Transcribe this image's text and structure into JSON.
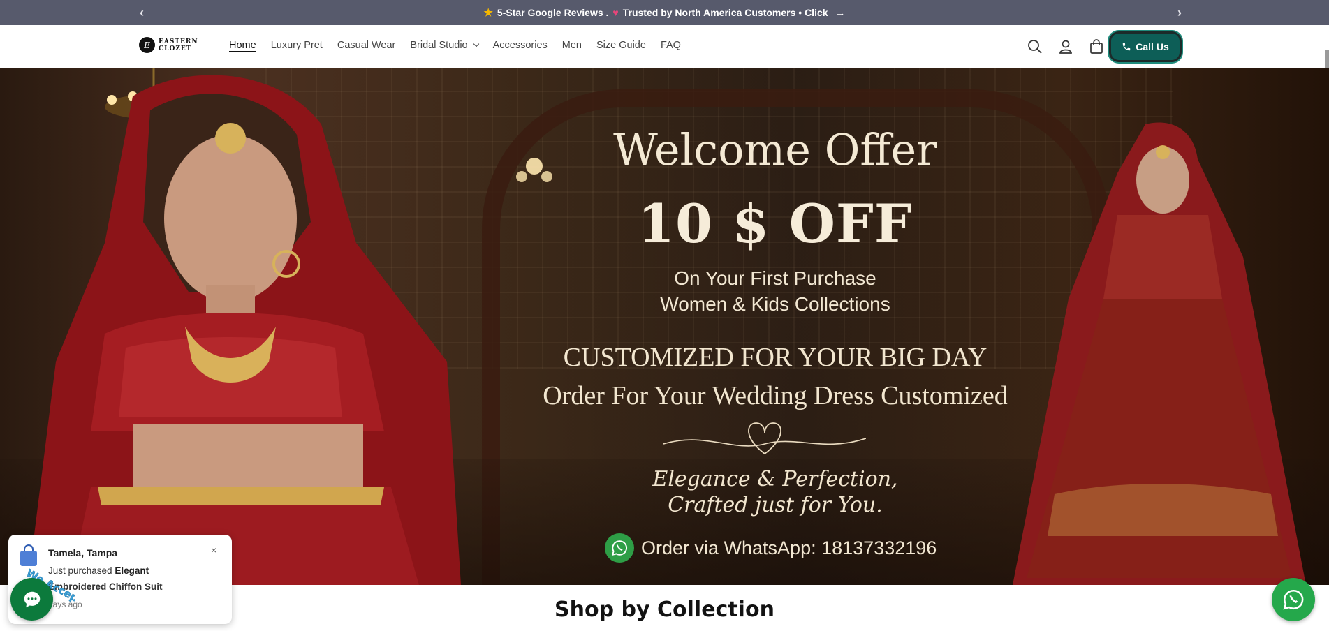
{
  "announcement": {
    "text": "5-Star Google Reviews . ",
    "text2": " Trusted by North America Customers • Click",
    "prev_icon": "chevron-left-icon",
    "next_icon": "chevron-right-icon"
  },
  "header": {
    "logo_line1": "EASTERN",
    "logo_line2": "CLOZET",
    "nav": [
      {
        "label": "Home",
        "active": true
      },
      {
        "label": "Luxury Pret"
      },
      {
        "label": "Casual Wear"
      },
      {
        "label": "Bridal Studio",
        "dropdown": true
      },
      {
        "label": "Accessories"
      },
      {
        "label": "Men"
      },
      {
        "label": "Size Guide"
      },
      {
        "label": "FAQ"
      }
    ],
    "call_label": "Call Us",
    "accent": "#0d5e57"
  },
  "hero": {
    "welcome": "Welcome Offer",
    "off": "10 $ OFF",
    "first_purchase": "On Your First Purchase",
    "collections": "Women & Kids Collections",
    "customized": "CUSTOMIZED FOR YOUR BIG DAY",
    "order_dress": "Order For Your Wedding Dress Customized",
    "elegance": "Elegance & Perfection,",
    "crafted": "Crafted just for You.",
    "whatsapp": "Order via WhatsApp: 18137332196"
  },
  "section": {
    "title": "Shop by Collection"
  },
  "popup": {
    "who": "Tamela, Tampa",
    "line1_prefix": "Just purchased ",
    "line1_product": "Elegant",
    "line2": "Embroidered Chiffon Suit",
    "when": "days ago",
    "close": "×"
  },
  "badge": {
    "text": "We Accept"
  }
}
